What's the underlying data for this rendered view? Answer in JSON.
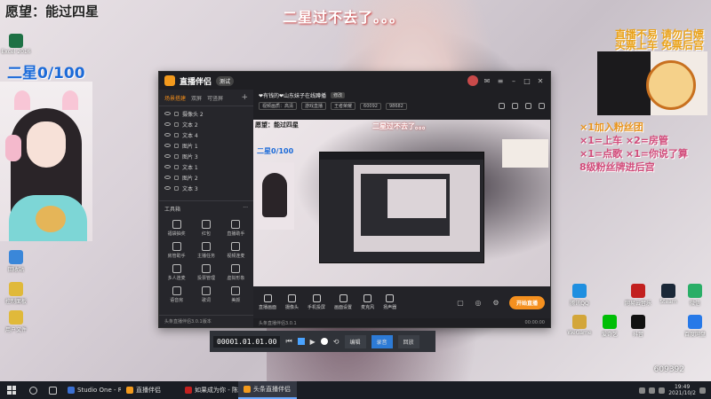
{
  "overlay": {
    "wish_text": "愿望：能过四星",
    "star_count": "二星0/100",
    "top_center_text": "二星过不去了。。。",
    "notice_line_1": "直播不易 请勿白嫖",
    "notice_line_2": "买票上车 免票后宫",
    "tips": [
      {
        "text": "×1加入粉丝团",
        "color": "#e8941d"
      },
      {
        "text": "×1=上车  ×2=房管",
        "color": "#d14b7a"
      },
      {
        "text": "×1=点歌  ×1=你说了算",
        "color": "#d14b7a"
      },
      {
        "text": "8级粉丝牌进后宫",
        "color": "#d14b7a"
      }
    ],
    "viewer_count": "609392"
  },
  "desktop_icons_left": [
    {
      "label": "Excel 2016",
      "color": "#1e7145"
    },
    {
      "label": "回收站",
      "color": "#3a87d9"
    },
    {
      "label": "控制面板",
      "color": "#e0b93a"
    },
    {
      "label": "用户文件",
      "color": "#e0b93a"
    }
  ],
  "desktop_icons_right": [
    {
      "label": "腾讯QQ",
      "color": "#1f8fe0"
    },
    {
      "label": "网易云音乐",
      "color": "#c2201f"
    },
    {
      "label": "Steam",
      "color": "#1b2838"
    },
    {
      "label": "微信",
      "color": "#2aae67"
    },
    {
      "label": "WeGame",
      "color": "#d3a63a"
    },
    {
      "label": "爱奇艺",
      "color": "#00be06"
    },
    {
      "label": "抖音",
      "color": "#111111"
    },
    {
      "label": "百度网盘",
      "color": "#2779e8"
    }
  ],
  "app": {
    "name": "直播伴侣",
    "badge": "测试",
    "tabs": [
      {
        "label": "场景搭建",
        "active": true
      },
      {
        "label": "双屏",
        "active": false
      },
      {
        "label": "可竖屏",
        "active": false
      }
    ],
    "tab_add": "+",
    "sources": [
      "摄像头 2",
      "文本 2",
      "文本 4",
      "图片 1",
      "图片 3",
      "文本 1",
      "图片 2",
      "文本 3"
    ],
    "tools_header": "工具箱",
    "tools_more": "···",
    "tools": [
      "福袋抽奖",
      "红包",
      "直播助手",
      "房管助手",
      "主播任务",
      "视频连麦",
      "多人连麦",
      "投票管理",
      "虚拟形象",
      "语音房",
      "歌词",
      "美颜"
    ],
    "left_footer": "头条直播伴侣3.0.1版本",
    "room_title": "❤有钱的❤山东妹子在线蹲播",
    "room_tag": "修改",
    "room_chips": [
      "视频画质：高清",
      "游戏直播",
      "王者荣耀",
      "60092",
      "98682"
    ],
    "controls": [
      "直播画面",
      "摄像头",
      "手机投屏",
      "画面设置",
      "麦克风",
      "扬声器"
    ],
    "start_live": "开始直播",
    "status_left": "头条直播伴侣3.0.1",
    "status_right": "00:00:00"
  },
  "playbar": {
    "time": "00001.01.01.00",
    "modes": [
      {
        "label": "编辑",
        "active": false
      },
      {
        "label": "录音",
        "active": true
      },
      {
        "label": "回放",
        "active": false
      }
    ]
  },
  "taskbar": {
    "tasks": [
      {
        "label": "Studio One - RM...",
        "color": "#3b6fd1",
        "active": false
      },
      {
        "label": "直播伴侣",
        "color": "#f39a1d",
        "active": false
      },
      {
        "label": "如果成为你 - 陈奕...",
        "color": "#c2201f",
        "active": false
      },
      {
        "label": "头条直播伴侣",
        "color": "#f39a1d",
        "active": true
      }
    ],
    "clock_time": "19:49",
    "clock_date": "2021/10/2"
  }
}
